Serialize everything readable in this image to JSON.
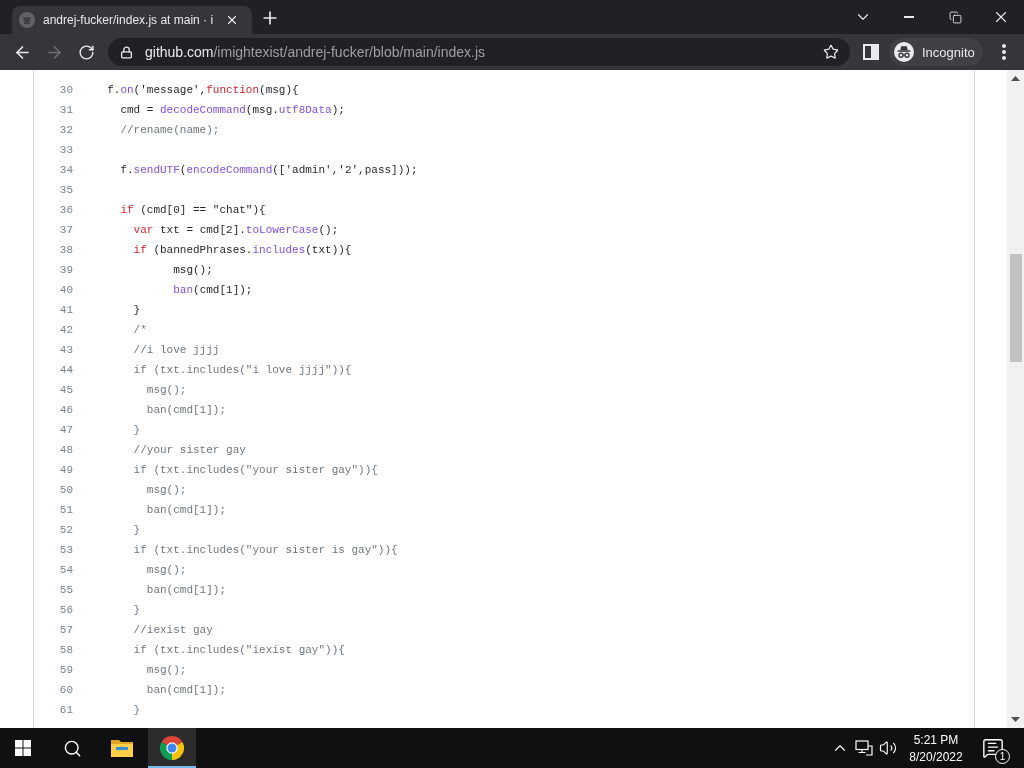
{
  "browser_window": {
    "tabs": [
      {
        "title": "andrej-fucker/index.js at main · i",
        "selected": true
      }
    ],
    "nav_buttons": [
      {
        "kind": "back",
        "disabled": false
      },
      {
        "kind": "forward",
        "disabled": true
      },
      {
        "kind": "reload",
        "disabled": false
      }
    ],
    "address_bar": {
      "host": "github.com",
      "path": "/imightexist/andrej-fucker/blob/main/index.js"
    },
    "profile": {
      "label": "Incognito"
    }
  },
  "code_view": {
    "lines": [
      {
        "number": "30",
        "tokens": [
          {
            "kind": "plain",
            "text": "  f."
          },
          {
            "kind": "entity",
            "text": "on"
          },
          {
            "kind": "plain",
            "text": "('message',"
          },
          {
            "kind": "keyword",
            "text": "function"
          },
          {
            "kind": "plain",
            "text": "(msg){"
          }
        ]
      },
      {
        "number": "31",
        "tokens": [
          {
            "kind": "plain",
            "text": "    cmd = "
          },
          {
            "kind": "entity",
            "text": "decodeCommand"
          },
          {
            "kind": "plain",
            "text": "(msg."
          },
          {
            "kind": "entity",
            "text": "utf8Data"
          },
          {
            "kind": "plain",
            "text": ");"
          }
        ]
      },
      {
        "number": "32",
        "tokens": [
          {
            "kind": "comment",
            "text": "    //rename(name);"
          }
        ]
      },
      {
        "number": "33"
      },
      {
        "number": "34",
        "tokens": [
          {
            "kind": "plain",
            "text": "    f."
          },
          {
            "kind": "entity",
            "text": "sendUTF"
          },
          {
            "kind": "plain",
            "text": "("
          },
          {
            "kind": "entity",
            "text": "encodeCommand"
          },
          {
            "kind": "plain",
            "text": "(['admin','2',pass]));"
          }
        ]
      },
      {
        "number": "35"
      },
      {
        "number": "36",
        "tokens": [
          {
            "kind": "keyword",
            "text": "    if"
          },
          {
            "kind": "plain",
            "text": " (cmd[0] == \"chat\"){"
          }
        ]
      },
      {
        "number": "37",
        "tokens": [
          {
            "kind": "keyword",
            "text": "      var"
          },
          {
            "kind": "plain",
            "text": " txt = cmd[2]."
          },
          {
            "kind": "entity",
            "text": "toLowerCase"
          },
          {
            "kind": "plain",
            "text": "();"
          }
        ]
      },
      {
        "number": "38",
        "tokens": [
          {
            "kind": "keyword",
            "text": "      if"
          },
          {
            "kind": "plain",
            "text": " (bannedPhrases."
          },
          {
            "kind": "entity",
            "text": "includes"
          },
          {
            "kind": "plain",
            "text": "(txt)){"
          }
        ]
      },
      {
        "number": "39",
        "tokens": [
          {
            "kind": "plain",
            "text": "            msg();"
          }
        ]
      },
      {
        "number": "40",
        "tokens": [
          {
            "kind": "entity",
            "text": "            ban"
          },
          {
            "kind": "plain",
            "text": "(cmd[1]);"
          }
        ]
      },
      {
        "number": "41",
        "tokens": [
          {
            "kind": "plain",
            "text": "      }"
          }
        ]
      },
      {
        "number": "42",
        "tokens": [
          {
            "kind": "comment",
            "text": "      /*"
          }
        ]
      },
      {
        "number": "43",
        "tokens": [
          {
            "kind": "comment",
            "text": "      //i love jjjj"
          }
        ]
      },
      {
        "number": "44",
        "tokens": [
          {
            "kind": "comment",
            "text": "      if (txt.includes(\"i love jjjj\")){"
          }
        ]
      },
      {
        "number": "45",
        "tokens": [
          {
            "kind": "comment",
            "text": "        msg();"
          }
        ]
      },
      {
        "number": "46",
        "tokens": [
          {
            "kind": "comment",
            "text": "        ban(cmd[1]);"
          }
        ]
      },
      {
        "number": "47",
        "tokens": [
          {
            "kind": "comment",
            "text": "      }"
          }
        ]
      },
      {
        "number": "48",
        "tokens": [
          {
            "kind": "comment",
            "text": "      //your sister gay"
          }
        ]
      },
      {
        "number": "49",
        "tokens": [
          {
            "kind": "comment",
            "text": "      if (txt.includes(\"your sister gay\")){"
          }
        ]
      },
      {
        "number": "50",
        "tokens": [
          {
            "kind": "comment",
            "text": "        msg();"
          }
        ]
      },
      {
        "number": "51",
        "tokens": [
          {
            "kind": "comment",
            "text": "        ban(cmd[1]);"
          }
        ]
      },
      {
        "number": "52",
        "tokens": [
          {
            "kind": "comment",
            "text": "      }"
          }
        ]
      },
      {
        "number": "53",
        "tokens": [
          {
            "kind": "comment",
            "text": "      if (txt.includes(\"your sister is gay\")){"
          }
        ]
      },
      {
        "number": "54",
        "tokens": [
          {
            "kind": "comment",
            "text": "        msg();"
          }
        ]
      },
      {
        "number": "55",
        "tokens": [
          {
            "kind": "comment",
            "text": "        ban(cmd[1]);"
          }
        ]
      },
      {
        "number": "56",
        "tokens": [
          {
            "kind": "comment",
            "text": "      }"
          }
        ]
      },
      {
        "number": "57",
        "tokens": [
          {
            "kind": "comment",
            "text": "      //iexist gay"
          }
        ]
      },
      {
        "number": "58",
        "tokens": [
          {
            "kind": "comment",
            "text": "      if (txt.includes(\"iexist gay\")){"
          }
        ]
      },
      {
        "number": "59",
        "tokens": [
          {
            "kind": "comment",
            "text": "        msg();"
          }
        ]
      },
      {
        "number": "60",
        "tokens": [
          {
            "kind": "comment",
            "text": "        ban(cmd[1]);"
          }
        ]
      },
      {
        "number": "61",
        "tokens": [
          {
            "kind": "comment",
            "text": "      }"
          }
        ]
      }
    ]
  },
  "taskbar": {
    "apps": [
      {
        "kind": "file-explorer",
        "selected": false
      },
      {
        "kind": "browser",
        "selected": true
      }
    ],
    "clock": {
      "time": "5:21 PM",
      "date": "8/20/2022"
    },
    "notifications": {
      "count": "1"
    }
  }
}
